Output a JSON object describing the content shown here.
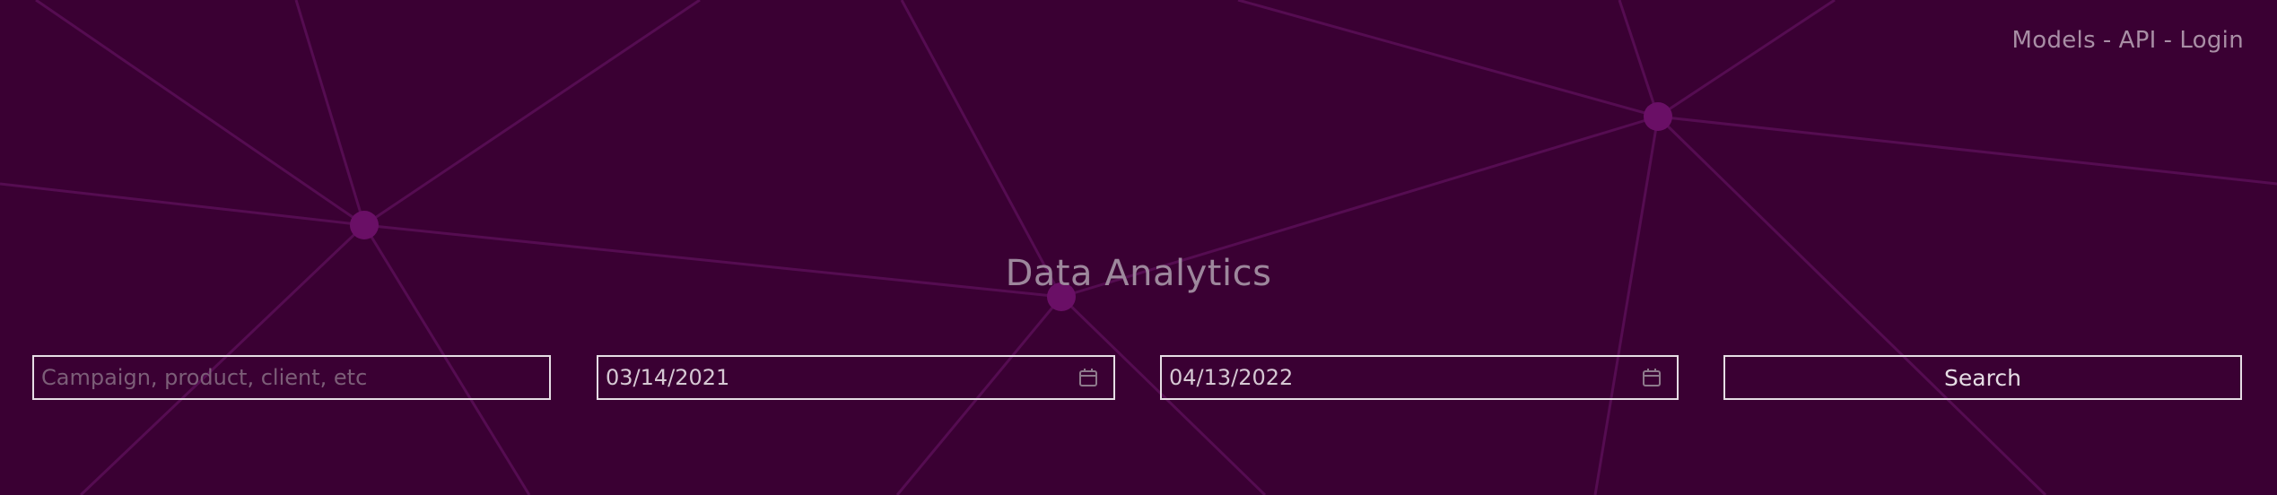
{
  "nav": {
    "models": "Models",
    "sep1": "-",
    "api": "API",
    "sep2": "-",
    "login": "Login"
  },
  "title": "Data Analytics",
  "search": {
    "placeholder": "Campaign, product, client, etc",
    "value": ""
  },
  "date_from": {
    "value": "03/14/2021"
  },
  "date_to": {
    "value": "04/13/2022"
  },
  "search_button": {
    "label": "Search"
  },
  "colors": {
    "background": "#3a0033",
    "network_line": "#5a0f57",
    "network_node": "#6a0f66",
    "text_muted": "#a88ea5",
    "border": "#e6dde5"
  },
  "icons": {
    "calendar": "calendar-icon"
  }
}
